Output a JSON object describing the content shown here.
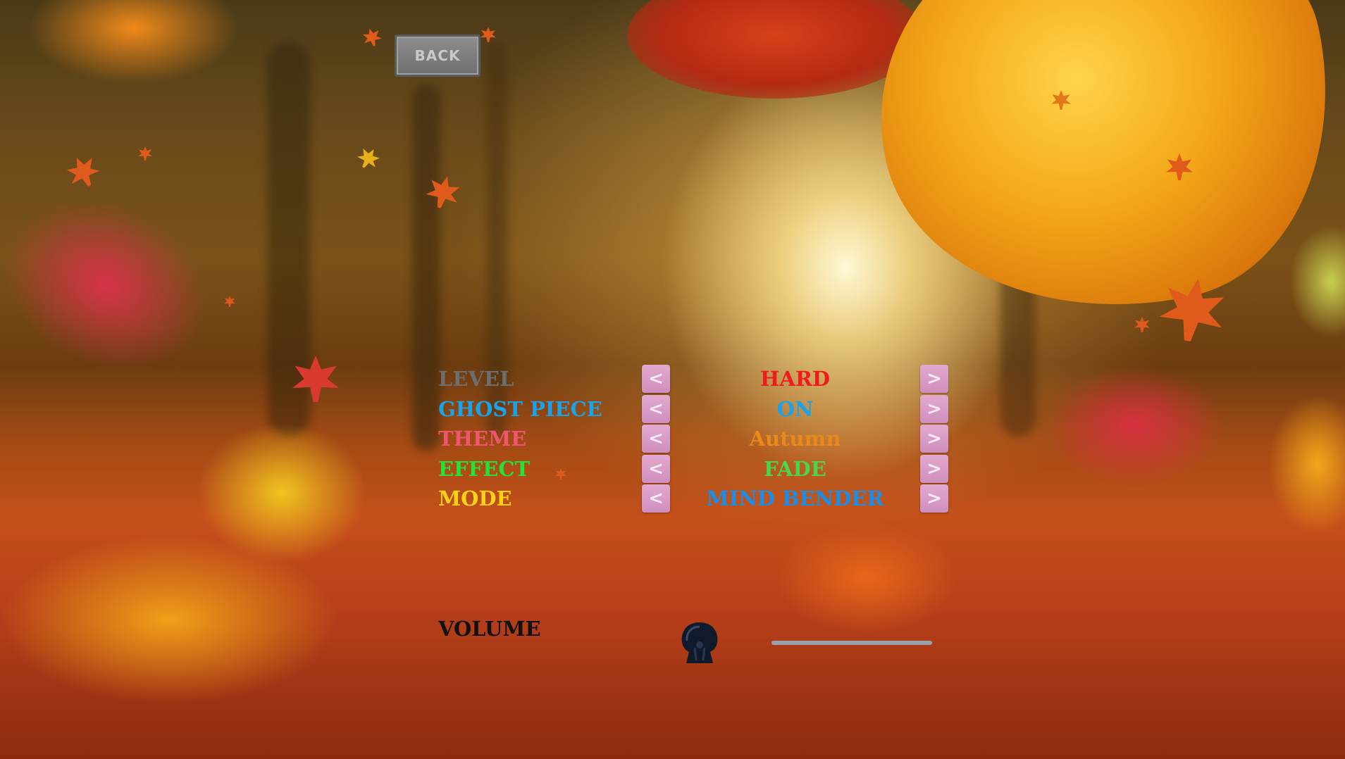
{
  "back_button": {
    "label": "BACK"
  },
  "options": [
    {
      "label": "LEVEL",
      "label_color": "#6e6e6e",
      "value": "HARD",
      "value_color": "#ee1c1c"
    },
    {
      "label": "GHOST PIECE",
      "label_color": "#1aa3e8",
      "value": "ON",
      "value_color": "#1aa3e8"
    },
    {
      "label": "THEME",
      "label_color": "#f0556e",
      "value": "Autumn",
      "value_color": "#e8891a"
    },
    {
      "label": "EFFECT",
      "label_color": "#22e33a",
      "value": "FADE",
      "value_color": "#49d64e"
    },
    {
      "label": "MODE",
      "label_color": "#ffd21a",
      "value": "MIND BENDER",
      "value_color": "#1a8ee8"
    }
  ],
  "arrows": {
    "left": "<",
    "right": ">"
  },
  "volume": {
    "label": "VOLUME",
    "icon": "bell-speaker-icon",
    "level": 1.0
  }
}
